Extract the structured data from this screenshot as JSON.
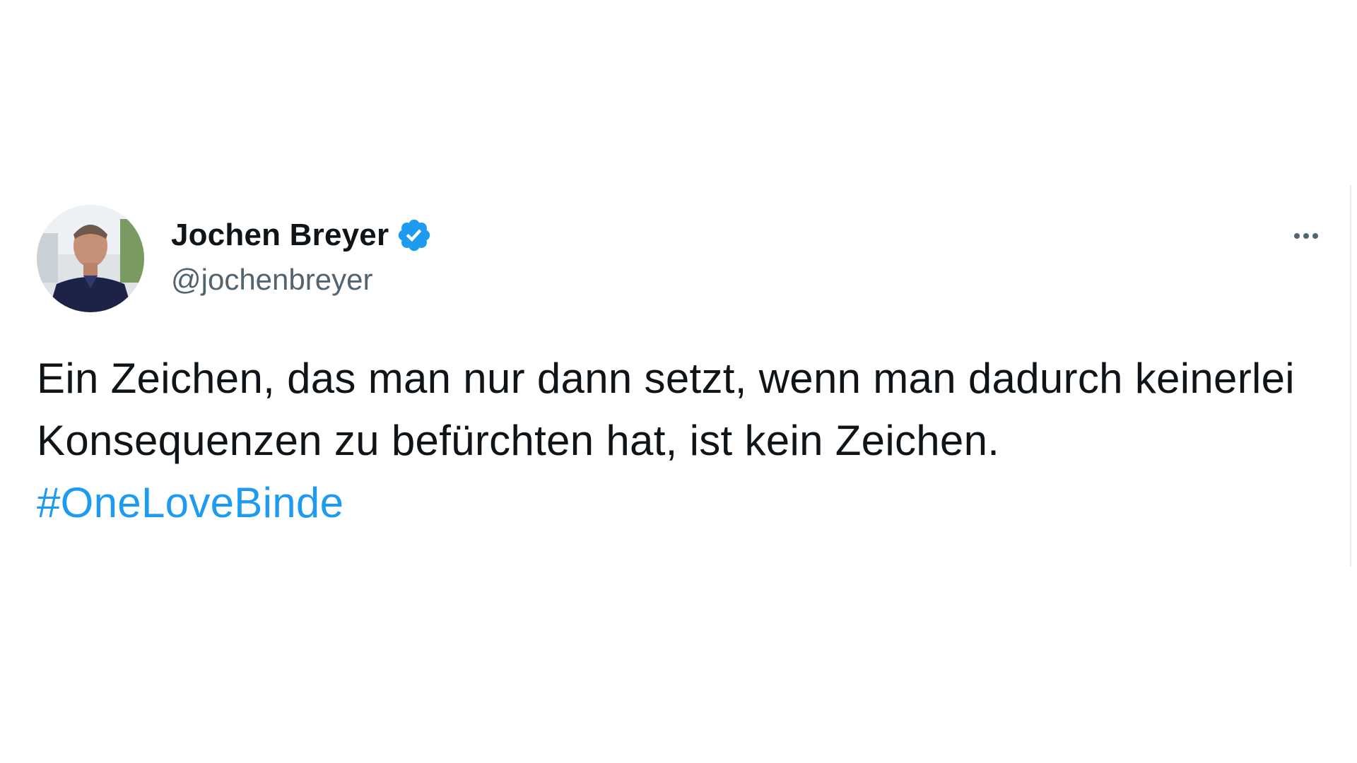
{
  "tweet": {
    "author": {
      "display_name": "Jochen Breyer",
      "handle": "@jochenbreyer",
      "verified": true
    },
    "text": {
      "body": "Ein Zeichen, das man nur dann setzt, wenn man dadurch keinerlei Konsequenzen zu befürchten hat, ist kein Zeichen. ",
      "hashtag": "#OneLoveBinde"
    },
    "icons": {
      "verified": "verified-badge-icon",
      "more": "more-options-icon"
    },
    "colors": {
      "text": "#0f1419",
      "secondary": "#536471",
      "accent": "#1d9bf0"
    }
  }
}
